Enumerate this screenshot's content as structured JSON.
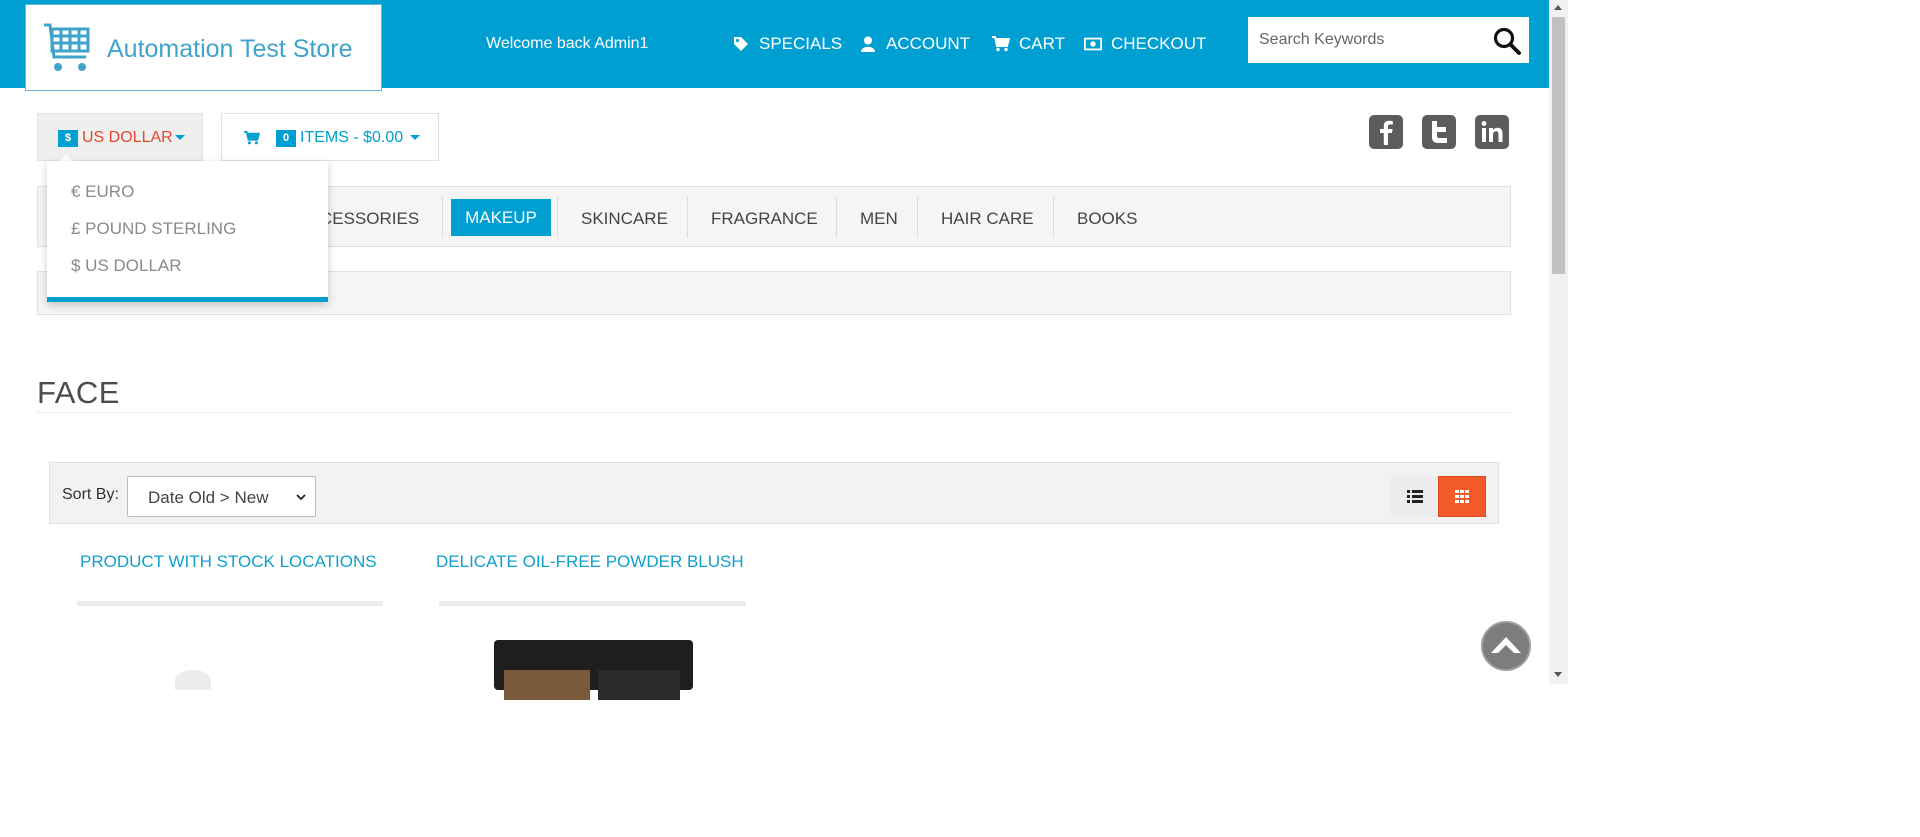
{
  "header": {
    "store_name": "Automation Test Store",
    "welcome": "Welcome back Admin1",
    "nav": [
      {
        "label": "SPECIALS",
        "icon": "tag-icon"
      },
      {
        "label": "ACCOUNT",
        "icon": "user-icon"
      },
      {
        "label": "CART",
        "icon": "cart-icon"
      },
      {
        "label": "CHECKOUT",
        "icon": "money-icon"
      }
    ],
    "search": {
      "placeholder": "Search Keywords",
      "value": ""
    },
    "brand_color": "#009fd1"
  },
  "currency": {
    "badge": "$",
    "selected": "US DOLLAR",
    "options": [
      "€ EURO",
      "£ POUND STERLING",
      "$ US DOLLAR"
    ]
  },
  "cart": {
    "count": "0",
    "label": "ITEMS - $0.00"
  },
  "social": [
    "facebook-icon",
    "twitter-icon",
    "linkedin-icon"
  ],
  "categories": {
    "items": [
      "ACCESSORIES",
      "MAKEUP",
      "SKINCARE",
      "FRAGRANCE",
      "MEN",
      "HAIR CARE",
      "BOOKS"
    ],
    "partial_first": "CESSORIES",
    "active": "MAKEUP"
  },
  "page": {
    "title": "FACE"
  },
  "sort": {
    "label": "Sort By:",
    "selected": "Date Old > New"
  },
  "products": [
    {
      "name": "PRODUCT WITH STOCK LOCATIONS"
    },
    {
      "name": "DELICATE OIL-FREE POWDER BLUSH"
    }
  ],
  "accent_color": "#f25a29"
}
